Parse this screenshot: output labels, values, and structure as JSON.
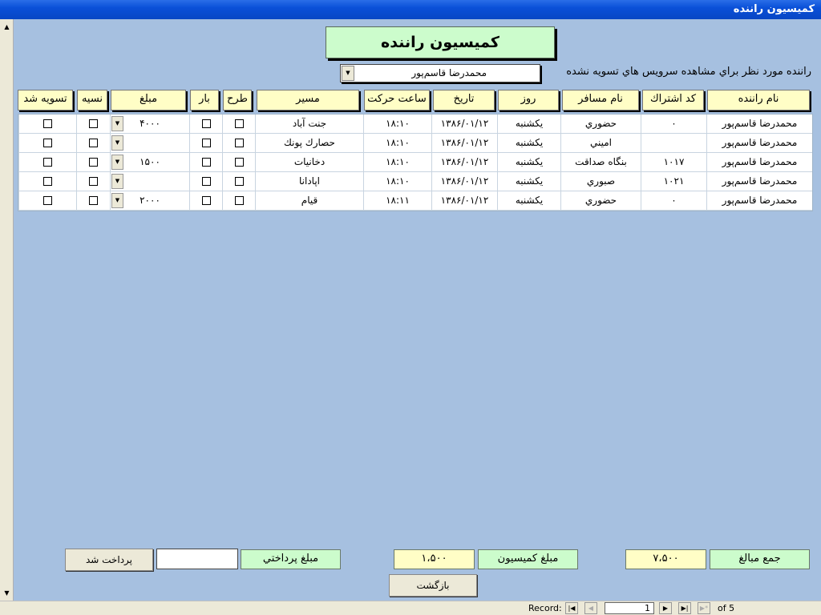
{
  "window": {
    "title": "كميسيون راننده"
  },
  "form": {
    "heading": "كميسيون راننده"
  },
  "filter": {
    "label": "راننده مورد نظر براي مشاهده سرويس هاي تسويه نشده",
    "selected": "محمدرضا قاسم‌پور"
  },
  "columns": [
    "نام راننده",
    "كد اشتراك",
    "نام مسافر",
    "روز",
    "تاريخ",
    "ساعت حركت",
    "مسير",
    "طرح",
    "بار",
    "مبلغ",
    "نسيه",
    "تسويه شد"
  ],
  "rows": [
    {
      "driver": "محمدرضا قاسم‌پور",
      "code": "۰",
      "passenger": "حضوري",
      "day": "يكشنبه",
      "date": "۱۳۸۶/۰۱/۱۲",
      "time": "۱۸:۱۰",
      "route": "جنت آباد",
      "tarh": false,
      "bar": false,
      "amount": "۴۰۰۰",
      "credit": false,
      "settled": false
    },
    {
      "driver": "محمدرضا قاسم‌پور",
      "code": "",
      "passenger": "اميني",
      "day": "يكشنبه",
      "date": "۱۳۸۶/۰۱/۱۲",
      "time": "۱۸:۱۰",
      "route": "حصارك پونك",
      "tarh": false,
      "bar": false,
      "amount": "",
      "credit": false,
      "settled": false
    },
    {
      "driver": "محمدرضا قاسم‌پور",
      "code": "۱۰۱۷",
      "passenger": "بنگاه صداقت",
      "day": "يكشنبه",
      "date": "۱۳۸۶/۰۱/۱۲",
      "time": "۱۸:۱۰",
      "route": "دخانيات",
      "tarh": false,
      "bar": false,
      "amount": "۱۵۰۰",
      "credit": false,
      "settled": false
    },
    {
      "driver": "محمدرضا قاسم‌پور",
      "code": "۱۰۲۱",
      "passenger": "صبوري",
      "day": "يكشنبه",
      "date": "۱۳۸۶/۰۱/۱۲",
      "time": "۱۸:۱۰",
      "route": "اپادانا",
      "tarh": false,
      "bar": false,
      "amount": "",
      "credit": false,
      "settled": false
    },
    {
      "driver": "محمدرضا قاسم‌پور",
      "code": "۰",
      "passenger": "حضوري",
      "day": "يكشنبه",
      "date": "۱۳۸۶/۰۱/۱۲",
      "time": "۱۸:۱۱",
      "route": "قيام",
      "tarh": false,
      "bar": false,
      "amount": "۲۰۰۰",
      "credit": false,
      "settled": false
    }
  ],
  "summary": {
    "total_label": "جمع  مبالغ",
    "total_value": "۷،۵۰۰",
    "commission_label": "مبلغ كميسيون",
    "commission_value": "۱،۵۰۰",
    "payment_label": "مبلغ پرداختي",
    "payment_value": ""
  },
  "buttons": {
    "paid": "پرداخت شد",
    "back": "بازگشت"
  },
  "navigation": {
    "record_label": "Record:",
    "current": "1",
    "of_label": "of",
    "total": "5"
  }
}
